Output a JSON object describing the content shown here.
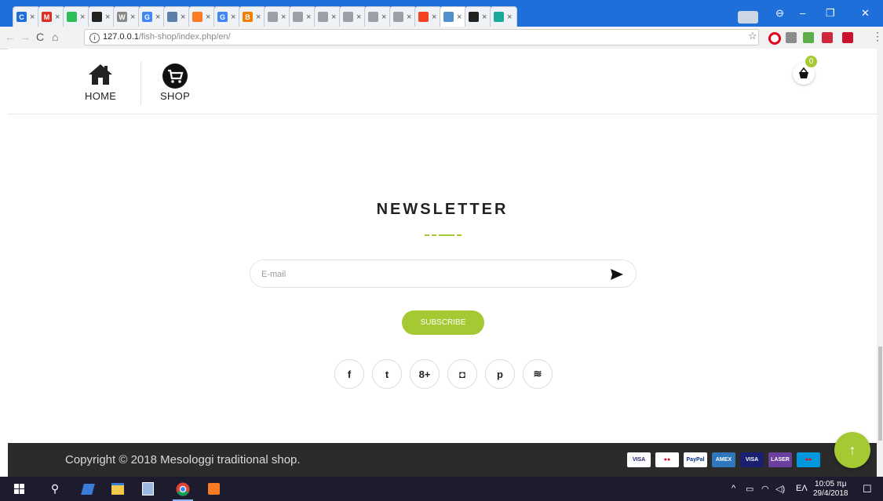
{
  "browser": {
    "tabs": [
      {
        "icon": "c-icon",
        "color": "#1e6fd9",
        "glyph": "C"
      },
      {
        "icon": "gmail-icon",
        "color": "#d93025",
        "glyph": "M"
      },
      {
        "icon": "green-icon",
        "color": "#2ebd59",
        "glyph": ""
      },
      {
        "icon": "github-icon",
        "color": "#222222",
        "glyph": ""
      },
      {
        "icon": "wikipedia-icon",
        "color": "#888888",
        "glyph": "W"
      },
      {
        "icon": "google-icon",
        "color": "#4285f4",
        "glyph": "G"
      },
      {
        "icon": "page-icon",
        "color": "#5a7fa8",
        "glyph": ""
      },
      {
        "icon": "xampp-icon",
        "color": "#fb7a24",
        "glyph": ""
      },
      {
        "icon": "google-icon",
        "color": "#4285f4",
        "glyph": "G"
      },
      {
        "icon": "blogger-icon",
        "color": "#f57d00",
        "glyph": "B"
      },
      {
        "icon": "doc-icon",
        "color": "#9aa0a6",
        "glyph": ""
      },
      {
        "icon": "doc-icon",
        "color": "#9aa0a6",
        "glyph": ""
      },
      {
        "icon": "doc-icon",
        "color": "#9aa0a6",
        "glyph": ""
      },
      {
        "icon": "doc-icon",
        "color": "#9aa0a6",
        "glyph": ""
      },
      {
        "icon": "doc-icon",
        "color": "#9aa0a6",
        "glyph": ""
      },
      {
        "icon": "doc-icon",
        "color": "#9aa0a6",
        "glyph": ""
      },
      {
        "icon": "joomla-icon",
        "color": "#f44321",
        "glyph": ""
      },
      {
        "icon": "joomla-icon",
        "color": "#5091cd",
        "glyph": ""
      },
      {
        "icon": "github-icon",
        "color": "#222222",
        "glyph": ""
      },
      {
        "icon": "teal-icon",
        "color": "#1aa99a",
        "glyph": ""
      }
    ],
    "close_glyph": "×",
    "url_host": "127.0.0.1",
    "url_path": "/fish-shop/index.php/en/"
  },
  "site": {
    "nav": {
      "home_label": "HOME",
      "shop_label": "SHOP"
    },
    "cart_count": "0",
    "newsletter": {
      "title": "NEWSLETTER",
      "email_placeholder": "E-mail",
      "subscribe_label": "SUBSCRIBE"
    },
    "social": [
      {
        "name": "facebook-icon",
        "glyph": "f"
      },
      {
        "name": "twitter-icon",
        "glyph": "t"
      },
      {
        "name": "google-plus-icon",
        "glyph": "8+"
      },
      {
        "name": "instagram-icon",
        "glyph": "◘"
      },
      {
        "name": "pinterest-icon",
        "glyph": "p"
      },
      {
        "name": "rss-icon",
        "glyph": "≋"
      }
    ],
    "footer": {
      "copyright": "Copyright © 2018 Mesologgi traditional shop.",
      "cards": [
        {
          "name": "visa-card",
          "label": "VISA",
          "bg": "#ffffff",
          "fg": "#1a1f71"
        },
        {
          "name": "mastercard-card",
          "label": "●●",
          "bg": "#ffffff",
          "fg": "#eb001b"
        },
        {
          "name": "paypal-card",
          "label": "PayPal",
          "bg": "#ffffff",
          "fg": "#003087"
        },
        {
          "name": "amex-card",
          "label": "AMEX",
          "bg": "#2e77bc",
          "fg": "#ffffff"
        },
        {
          "name": "visa-electron-card",
          "label": "VISA",
          "bg": "#1a1f71",
          "fg": "#ffffff"
        },
        {
          "name": "laser-card",
          "label": "LASER",
          "bg": "#6a3fa0",
          "fg": "#ffffff"
        },
        {
          "name": "maestro-card",
          "label": "●●",
          "bg": "#0099df",
          "fg": "#ff0000"
        }
      ]
    }
  },
  "taskbar": {
    "lang": "ΕΛ",
    "time": "10:05 πμ",
    "date": "29/4/2018"
  },
  "colors": {
    "accent": "#a5c932",
    "footer_bg": "#2b2b2b",
    "tabstrip": "#1e6fd9"
  }
}
